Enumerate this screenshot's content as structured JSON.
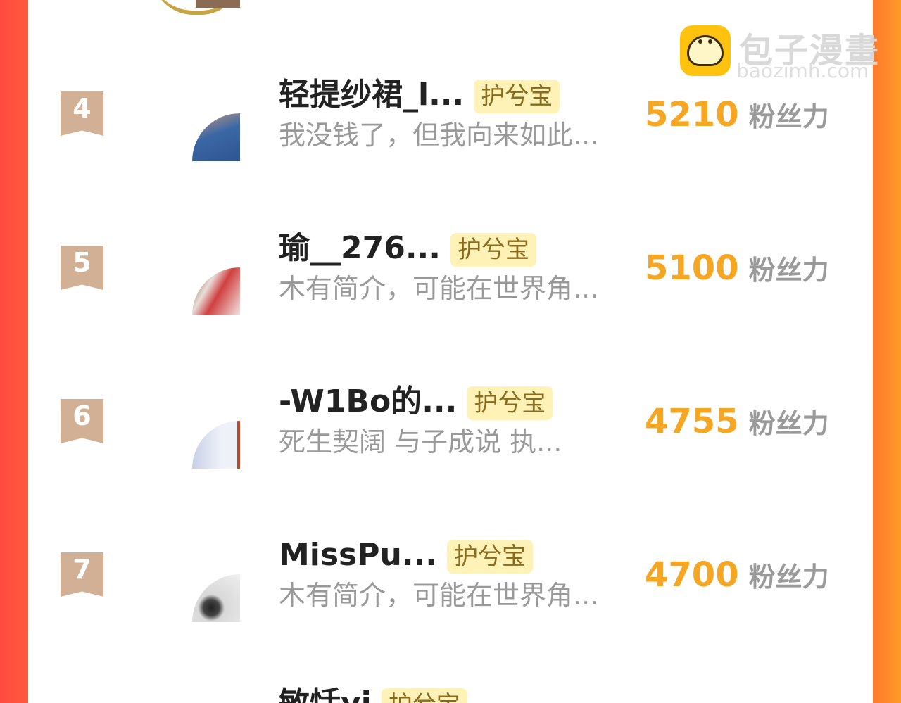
{
  "watermark": {
    "title": "包子漫畫",
    "subtitle": "baozimh.com"
  },
  "rows": [
    {
      "rank": "4",
      "name": "轻提纱裙_l...",
      "badge": "护兮宝",
      "bio": "我没钱了，但我向来如此...",
      "fans_value": "5210",
      "fans_unit": "粉丝力",
      "avatar_colors": [
        "#3b67a6",
        "#c89c7c"
      ]
    },
    {
      "rank": "5",
      "name": "瑜__276...",
      "badge": "护兮宝",
      "bio": "木有简介，可能在世界角...",
      "fans_value": "5100",
      "fans_unit": "粉丝力",
      "avatar_colors": [
        "#e8ddd8",
        "#c83030"
      ]
    },
    {
      "rank": "6",
      "name": "-W1Bo的...",
      "badge": "护兮宝",
      "bio": "死生契阔 与子成说 执...",
      "fans_value": "4755",
      "fans_unit": "粉丝力",
      "avatar_colors": [
        "#dde4f2",
        "#b84a2a"
      ]
    },
    {
      "rank": "7",
      "name": "MissPu...",
      "badge": "护兮宝",
      "bio": "木有简介，可能在世界角...",
      "fans_value": "4700",
      "fans_unit": "粉丝力",
      "avatar_colors": [
        "#e6e6e6",
        "#333333"
      ]
    },
    {
      "rank": "",
      "name": "敏恬yi",
      "badge": "护兮宝",
      "bio": "",
      "fans_value": "",
      "fans_unit": ""
    }
  ]
}
